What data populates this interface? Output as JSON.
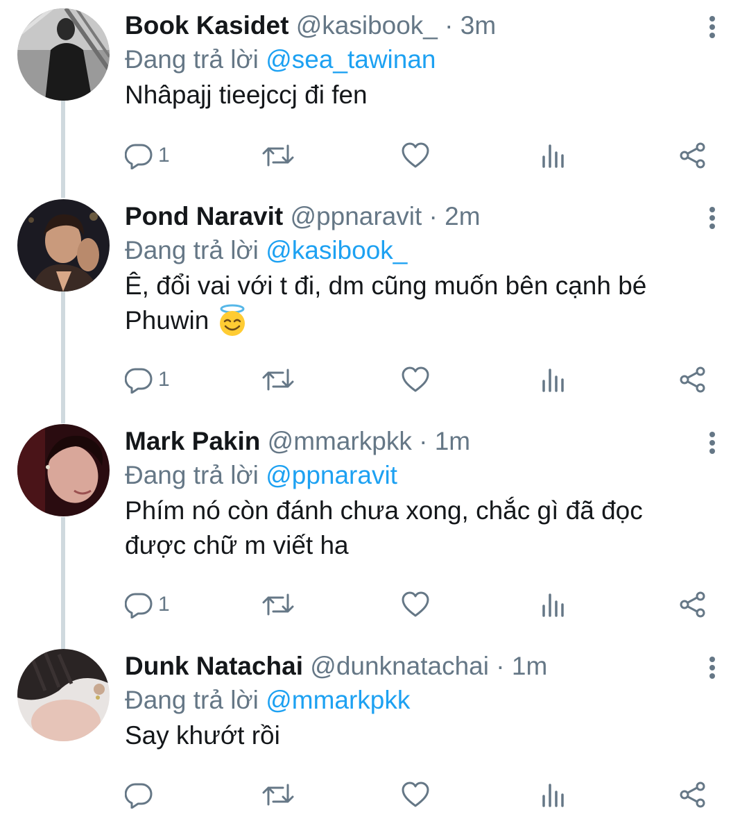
{
  "thread": {
    "replying_prefix": "Đang trả lời",
    "tweets": [
      {
        "name": "Book Kasidet",
        "handle": "@kasibook_",
        "time": "3m",
        "replying_to": "@sea_tawinan",
        "text": "Nhâpajj tieejccj đi fen",
        "reply_count": "1"
      },
      {
        "name": "Pond Naravit",
        "handle": "@ppnaravit",
        "time": "2m",
        "replying_to": "@kasibook_",
        "text_line1": "Ê, đổi vai với t đi, dm cũng muốn bên cạnh bé",
        "text_line2": "Phuwin",
        "emoji": "smiling-face-with-halo",
        "reply_count": "1"
      },
      {
        "name": "Mark Pakin",
        "handle": "@mmarkpkk",
        "time": "1m",
        "replying_to": "@ppnaravit",
        "text_line1": "Phím nó còn đánh chưa xong, chắc gì đã đọc",
        "text_line2": "được chữ m viết ha",
        "reply_count": "1"
      },
      {
        "name": "Dunk Natachai",
        "handle": "@dunknatachai",
        "time": "1m",
        "replying_to": "@mmarkpkk",
        "text": "Say khướt rồi",
        "reply_count": ""
      }
    ]
  },
  "separator": " · ",
  "colors": {
    "text": "#14171a",
    "secondary": "#657786",
    "link": "#1da1f2",
    "thread_line": "#cfd9de"
  },
  "icons": [
    "reply-icon",
    "retweet-icon",
    "like-icon",
    "analytics-icon",
    "share-icon",
    "more-icon"
  ]
}
